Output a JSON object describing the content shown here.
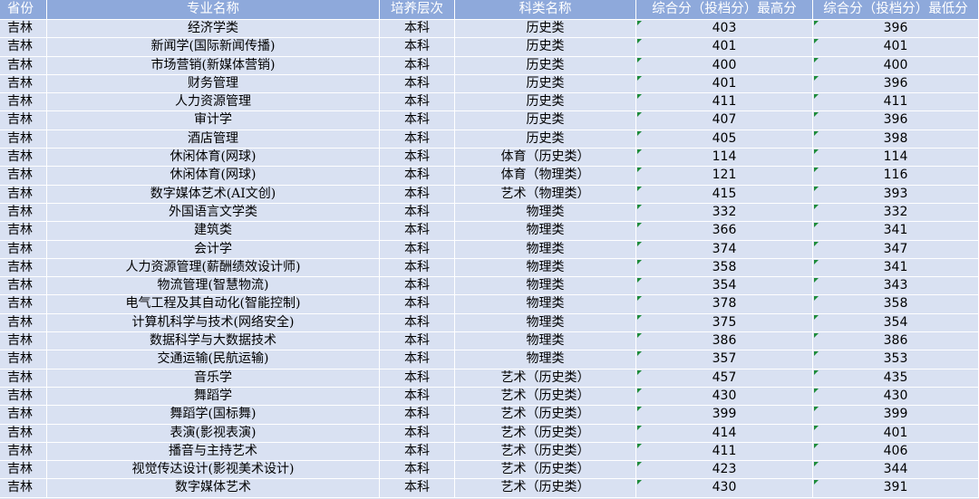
{
  "table": {
    "headers": [
      "省份",
      "专业名称",
      "培养层次",
      "科类名称",
      "综合分（投档分）最高分",
      "综合分（投档分）最低分"
    ],
    "rows": [
      [
        "吉林",
        "经济学类",
        "本科",
        "历史类",
        "403",
        "396"
      ],
      [
        "吉林",
        "新闻学(国际新闻传播)",
        "本科",
        "历史类",
        "401",
        "401"
      ],
      [
        "吉林",
        "市场营销(新媒体营销)",
        "本科",
        "历史类",
        "400",
        "400"
      ],
      [
        "吉林",
        "财务管理",
        "本科",
        "历史类",
        "401",
        "396"
      ],
      [
        "吉林",
        "人力资源管理",
        "本科",
        "历史类",
        "411",
        "411"
      ],
      [
        "吉林",
        "审计学",
        "本科",
        "历史类",
        "407",
        "396"
      ],
      [
        "吉林",
        "酒店管理",
        "本科",
        "历史类",
        "405",
        "398"
      ],
      [
        "吉林",
        "休闲体育(网球)",
        "本科",
        "体育（历史类）",
        "114",
        "114"
      ],
      [
        "吉林",
        "休闲体育(网球)",
        "本科",
        "体育（物理类）",
        "121",
        "116"
      ],
      [
        "吉林",
        "数字媒体艺术(AI文创)",
        "本科",
        "艺术（物理类）",
        "415",
        "393"
      ],
      [
        "吉林",
        "外国语言文学类",
        "本科",
        "物理类",
        "332",
        "332"
      ],
      [
        "吉林",
        "建筑类",
        "本科",
        "物理类",
        "366",
        "341"
      ],
      [
        "吉林",
        "会计学",
        "本科",
        "物理类",
        "374",
        "347"
      ],
      [
        "吉林",
        "人力资源管理(薪酬绩效设计师)",
        "本科",
        "物理类",
        "358",
        "341"
      ],
      [
        "吉林",
        "物流管理(智慧物流)",
        "本科",
        "物理类",
        "354",
        "343"
      ],
      [
        "吉林",
        "电气工程及其自动化(智能控制)",
        "本科",
        "物理类",
        "378",
        "358"
      ],
      [
        "吉林",
        "计算机科学与技术(网络安全)",
        "本科",
        "物理类",
        "375",
        "354"
      ],
      [
        "吉林",
        "数据科学与大数据技术",
        "本科",
        "物理类",
        "386",
        "386"
      ],
      [
        "吉林",
        "交通运输(民航运输)",
        "本科",
        "物理类",
        "357",
        "353"
      ],
      [
        "吉林",
        "音乐学",
        "本科",
        "艺术（历史类）",
        "457",
        "435"
      ],
      [
        "吉林",
        "舞蹈学",
        "本科",
        "艺术（历史类）",
        "430",
        "430"
      ],
      [
        "吉林",
        "舞蹈学(国标舞)",
        "本科",
        "艺术（历史类）",
        "399",
        "399"
      ],
      [
        "吉林",
        "表演(影视表演)",
        "本科",
        "艺术（历史类）",
        "414",
        "401"
      ],
      [
        "吉林",
        "播音与主持艺术",
        "本科",
        "艺术（历史类）",
        "411",
        "406"
      ],
      [
        "吉林",
        "视觉传达设计(影视美术设计)",
        "本科",
        "艺术（历史类）",
        "423",
        "344"
      ],
      [
        "吉林",
        "数字媒体艺术",
        "本科",
        "艺术（历史类）",
        "430",
        "391"
      ]
    ]
  },
  "colors": {
    "header_bg": "#8ea9db",
    "row_bg": "#d9e1f2",
    "grid_line": "#ffffff",
    "error_marker": "#1e8c3a"
  }
}
